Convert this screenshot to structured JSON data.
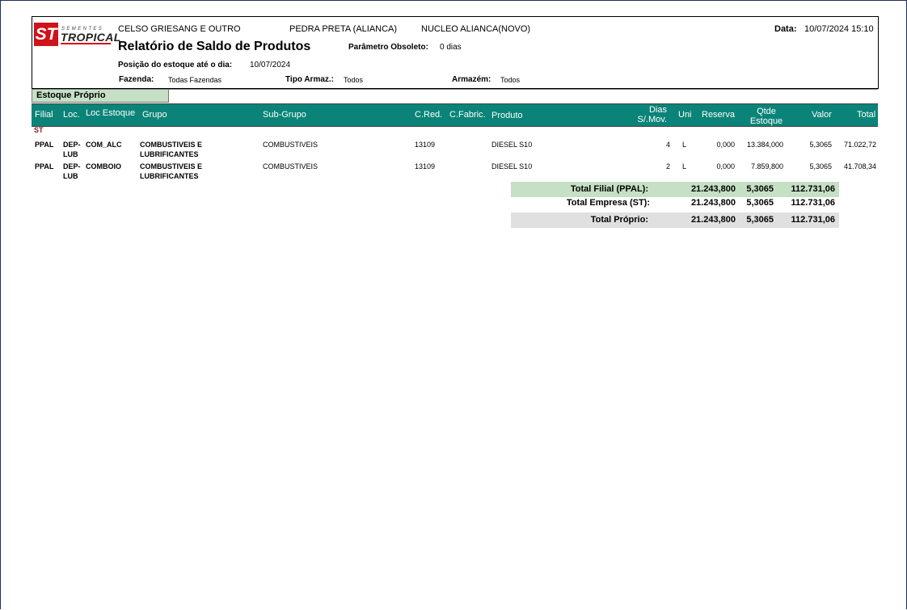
{
  "header": {
    "company": "CELSO GRIESANG E OUTRO",
    "farm_name": "PEDRA PRETA (ALIANCA)",
    "nucleus": "NUCLEO ALIANCA(NOVO)",
    "date_label": "Data:",
    "date_value": "10/07/2024 15:10",
    "report_title": "Relatório de Saldo de Produtos",
    "obsolete_label": "Parâmetro Obsoleto:",
    "obsolete_value": "0 dias",
    "position_label": "Posição do estoque até o dia:",
    "position_value": "10/07/2024",
    "fazenda_label": "Fazenda:",
    "fazenda_value": "Todas Fazendas",
    "tipo_label": "Tipo Armaz.:",
    "tipo_value": "Todos",
    "armazem_label": "Armazém:",
    "armazem_value": "Todos"
  },
  "logo": {
    "mark": "ST",
    "sementes": "SEMENTES",
    "tropical": "TROPICAL",
    "brand_color": "#d0121b"
  },
  "section_label": "Estoque Próprio",
  "columns": {
    "filial": "Filial",
    "loc": "Loc.",
    "loc_estoque": "Loc Estoque",
    "grupo": "Grupo",
    "subgrupo": "Sub-Grupo",
    "cred": "C.Red.",
    "cfabric": "C.Fabric.",
    "produto": "Produto",
    "dias_1": "Dias",
    "dias_2": "S/.Mov.",
    "uni": "Uni",
    "reserva": "Reserva",
    "qtde_1": "Qtde",
    "qtde_2": "Estoque",
    "valor": "Valor",
    "total": "Total"
  },
  "company_group": "ST",
  "rows": [
    {
      "filial": "PPAL",
      "loc_1": "DEP-",
      "loc_2": "LUB",
      "loc_estoque": "COM_ALC",
      "grupo_1": "COMBUSTIVEIS E",
      "grupo_2": "LUBRIFICANTES",
      "subgrupo": "COMBUSTIVEIS",
      "cred": "13109",
      "produto": "DIESEL S10",
      "dias": "4",
      "uni": "L",
      "reserva": "0,000",
      "qtde": "13.384,000",
      "valor": "5,3065",
      "total": "71.022,72"
    },
    {
      "filial": "PPAL",
      "loc_1": "DEP-",
      "loc_2": "LUB",
      "loc_estoque": "COMBOIO",
      "grupo_1": "COMBUSTIVEIS E",
      "grupo_2": "LUBRIFICANTES",
      "subgrupo": "COMBUSTIVEIS",
      "cred": "13109",
      "produto": "DIESEL S10",
      "dias": "2",
      "uni": "L",
      "reserva": "0,000",
      "qtde": "7.859,800",
      "valor": "5,3065",
      "total": "41.708,34"
    }
  ],
  "totals": [
    {
      "label": "Total Filial (PPAL):",
      "qtde": "21.243,800",
      "valor": "5,3065",
      "total": "112.731,06"
    },
    {
      "label": "Total Empresa (ST):",
      "qtde": "21.243,800",
      "valor": "5,3065",
      "total": "112.731,06"
    },
    {
      "label": "Total Próprio:",
      "qtde": "21.243,800",
      "valor": "5,3065",
      "total": "112.731,06"
    }
  ],
  "colors": {
    "table_header": "#0b8378",
    "subtotal_fill": "#c5e0c5",
    "grand_total_fill": "#e0e0e0"
  }
}
